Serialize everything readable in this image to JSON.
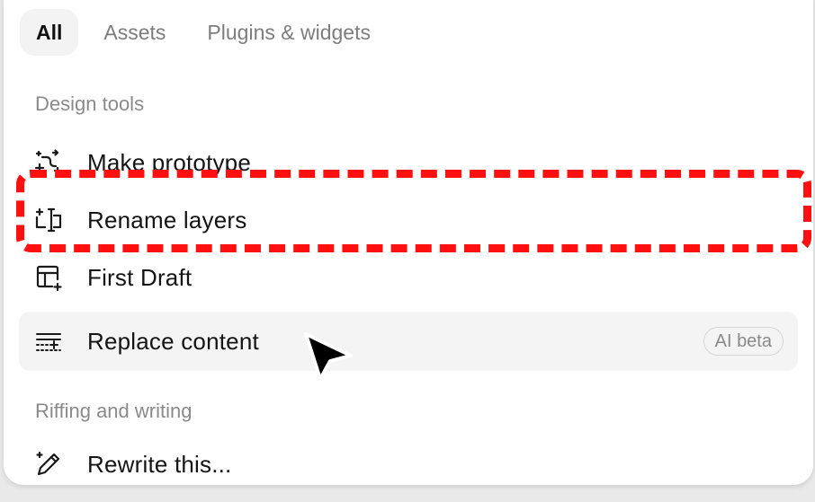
{
  "tabs": [
    {
      "label": "All",
      "active": true
    },
    {
      "label": "Assets",
      "active": false
    },
    {
      "label": "Plugins & widgets",
      "active": false
    }
  ],
  "sections": {
    "design_tools": "Design tools",
    "riffing": "Riffing and writing"
  },
  "items": {
    "make_prototype": {
      "label": "Make prototype",
      "icon": "prototype-icon"
    },
    "rename_layers": {
      "label": "Rename layers",
      "icon": "rename-layers-icon"
    },
    "first_draft": {
      "label": "First Draft",
      "icon": "first-draft-icon"
    },
    "replace_content": {
      "label": "Replace content",
      "icon": "replace-content-icon",
      "badge": "AI beta"
    },
    "rewrite": {
      "label": "Rewrite this...",
      "icon": "pencil-sparkle-icon"
    }
  },
  "colors": {
    "highlight": "#ff1010",
    "hover_bg": "#f4f4f4",
    "text": "#141414",
    "muted": "#8a8a8a"
  }
}
